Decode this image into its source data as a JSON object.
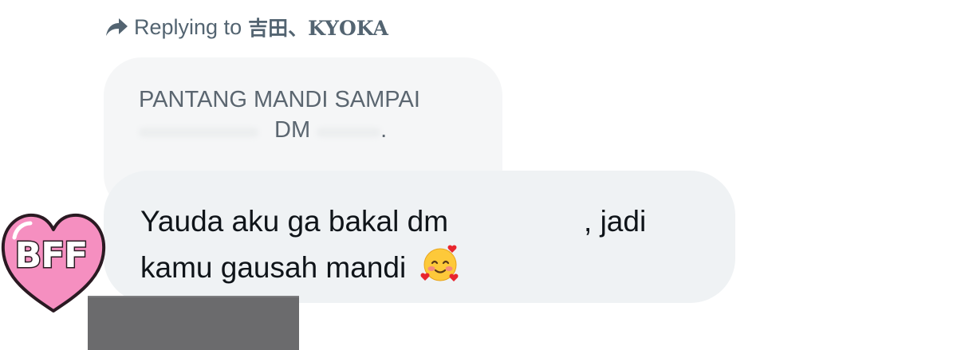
{
  "reply": {
    "prefix": "Replying to",
    "username": "吉田、KYOKA",
    "icon": "reply-arrow-icon"
  },
  "quoted_message": {
    "line1": "PANTANG MANDI SAMPAI",
    "line2_visible": "DM",
    "line2_end": "."
  },
  "message": {
    "text_part1": "Yauda aku ga bakal dm",
    "text_part2": ", jadi",
    "text_line2": "kamu gausah mandi",
    "emoji": "smiling-face-with-hearts"
  },
  "sticker": {
    "label": "BFF",
    "icon": "heart-icon",
    "color": "#f58fc0"
  },
  "colors": {
    "bubble_light": "#f5f6f7",
    "bubble_main": "#eff2f4",
    "text_main": "#0f1419",
    "text_muted": "#536471"
  }
}
